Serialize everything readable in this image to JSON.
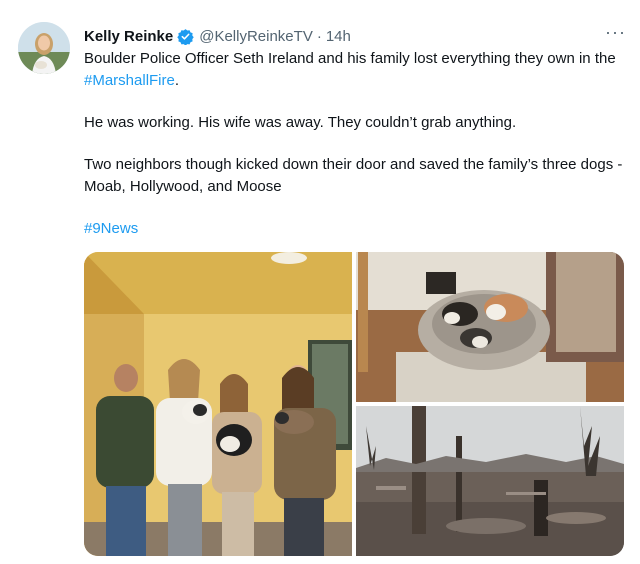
{
  "tweet": {
    "author_name": "Kelly Reinke",
    "author_handle": "@KellyReinkeTV",
    "separator": "·",
    "timestamp": "14h",
    "more_label": "···",
    "paragraph1_text": "Boulder Police Officer Seth Ireland and his family lost everything they own in the ",
    "paragraph1_hashtag": "#MarshallFire",
    "paragraph1_end": ".",
    "paragraph2": "He was working. His wife was away. They couldn’t grab anything.",
    "paragraph3": "Two neighbors though kicked down their door and saved the family’s three dogs - Moab, Hollywood, and Moose",
    "hashtag_line": "#9News"
  },
  "colors": {
    "link": "#1d9bf0",
    "secondary_text": "#536471",
    "verified_badge": "#1d9bf0"
  },
  "icons": {
    "verified": "verified-badge-icon",
    "more": "more-options-icon"
  }
}
